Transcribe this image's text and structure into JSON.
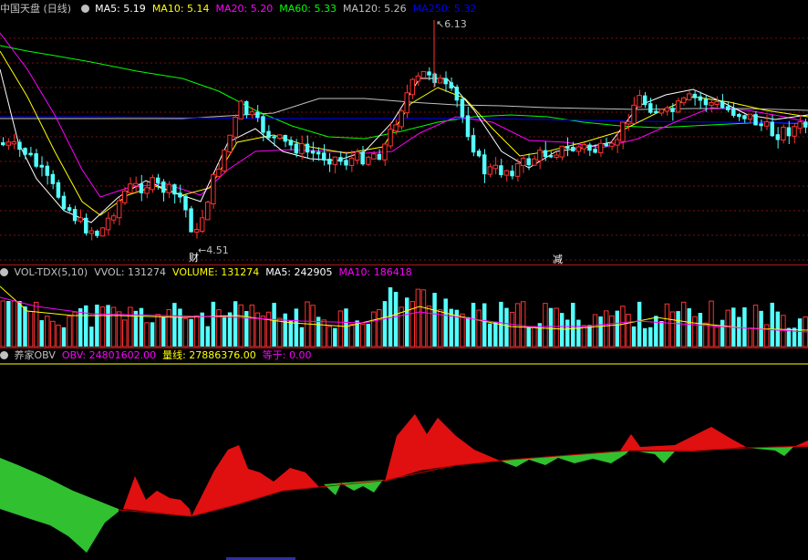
{
  "colors": {
    "up": "#ff3232",
    "down": "#54ffff",
    "ma5": "#ffffff",
    "ma10": "#ffff00",
    "ma20": "#ff00ff",
    "ma60": "#00ff00",
    "ma120": "#c0c0c0",
    "ma250": "#0000ff",
    "obv_up": "#e01010",
    "obv_down": "#30c030"
  },
  "main": {
    "title": "中国天盘 (日线)",
    "indicators": [
      {
        "label": "MA5: 5.19",
        "color": "#ffffff"
      },
      {
        "label": "MA10: 5.14",
        "color": "#ffff00"
      },
      {
        "label": "MA20: 5.20",
        "color": "#ff00ff"
      },
      {
        "label": "MA60: 5.33",
        "color": "#00ff00"
      },
      {
        "label": "MA120: 5.26",
        "color": "#c0c0c0"
      },
      {
        "label": "MA250: 5.32",
        "color": "#0000ff"
      }
    ],
    "high_label": "6.13",
    "low_label": "4.51",
    "marker_cai": "财",
    "marker_jian": "减"
  },
  "volume": {
    "indicators": [
      {
        "label": "VOL-TDX(5,10)",
        "color": "#c0c0c0"
      },
      {
        "label": "VVOL: 131274",
        "color": "#c0c0c0"
      },
      {
        "label": "VOLUME: 131274",
        "color": "#ffff00"
      },
      {
        "label": "MA5: 242905",
        "color": "#ffffff"
      },
      {
        "label": "MA10: 186418",
        "color": "#ff00ff"
      }
    ]
  },
  "obv": {
    "indicators": [
      {
        "label": "养家OBV",
        "color": "#c0c0c0"
      },
      {
        "label": "OBV: 24801602.00",
        "color": "#ff00ff"
      },
      {
        "label": "量线: 27886376.00",
        "color": "#ffff00"
      },
      {
        "label": "等于: 0.00",
        "color": "#ff00ff"
      }
    ]
  }
}
